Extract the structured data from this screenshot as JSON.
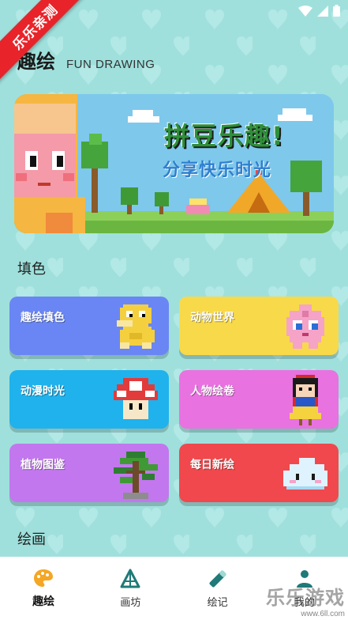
{
  "ribbon": {
    "label": "乐乐亲测"
  },
  "header": {
    "title": "趣绘",
    "subtitle": "FUN DRAWING"
  },
  "banner": {
    "headline": "拼豆乐趣!",
    "tagline": "分享快乐时光"
  },
  "sections": {
    "color_fill": "填色",
    "drawing": "绘画"
  },
  "cards": [
    {
      "label": "趣绘填色",
      "color": "#6a86f4",
      "icon": "duck-pixel-icon"
    },
    {
      "label": "动物世界",
      "color": "#f8d94a",
      "icon": "pink-balloon-creature-pixel-icon"
    },
    {
      "label": "动漫时光",
      "color": "#20b2ec",
      "icon": "mushroom-pixel-icon"
    },
    {
      "label": "人物绘卷",
      "color": "#e872e0",
      "icon": "princess-pixel-icon"
    },
    {
      "label": "植物图鉴",
      "color": "#c277ee",
      "icon": "bonsai-tree-pixel-icon"
    },
    {
      "label": "每日新绘",
      "color": "#f0484c",
      "icon": "cloud-pixel-icon"
    }
  ],
  "nav": [
    {
      "label": "趣绘",
      "icon": "palette-icon",
      "active": true
    },
    {
      "label": "画坊",
      "icon": "triangle-workshop-icon",
      "active": false
    },
    {
      "label": "绘记",
      "icon": "pencil-eraser-icon",
      "active": false
    },
    {
      "label": "我的",
      "icon": "person-icon",
      "active": false
    }
  ],
  "watermark": {
    "brand": "乐乐游戏",
    "url": "www.6ll.com"
  },
  "colors": {
    "background": "#9fe0dc",
    "accent": "#f5a623"
  }
}
